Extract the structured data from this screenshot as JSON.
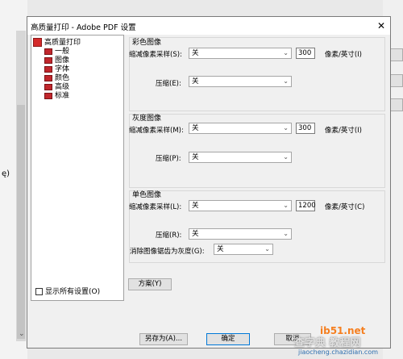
{
  "background": {
    "left_char": "ę)",
    "right_buttons": [
      "..",
      "...",
      "新(E)..."
    ]
  },
  "dialog": {
    "title": "高质量打印 - Adobe PDF 设置",
    "close": "✕"
  },
  "tree": {
    "root": "高质量打印",
    "items": [
      "一般",
      "图像",
      "字体",
      "颜色",
      "高级",
      "标准"
    ]
  },
  "show_all_settings": "显示所有设置(O)",
  "color": {
    "group": "彩色图像",
    "downsample_label": "缩减像素采样(S):",
    "downsample_value": "关",
    "resolution": "300",
    "unit_label": "像素/英寸(I)",
    "compress_label": "压缩(E):",
    "compress_value": "关"
  },
  "gray": {
    "group": "灰度图像",
    "downsample_label": "缩减像素采样(M):",
    "downsample_value": "关",
    "resolution": "300",
    "unit_label": "像素/英寸(I)",
    "compress_label": "压缩(P):",
    "compress_value": "关"
  },
  "mono": {
    "group": "单色图像",
    "downsample_label": "缩减像素采样(L):",
    "downsample_value": "关",
    "resolution": "1200",
    "unit_label": "像素/英寸(C)",
    "compress_label": "压缩(R):",
    "compress_value": "关",
    "antialias_label": "消除图像锯齿为灰度(G):",
    "antialias_value": "关"
  },
  "buttons": {
    "scheme": "方案(Y)",
    "save_as": "另存为(A)...",
    "ok": "确定",
    "cancel": "取消"
  },
  "watermark": {
    "line1": "ib51.net",
    "line2": "查字典 教程网",
    "line3": "jiaocheng.chazidian.com"
  }
}
